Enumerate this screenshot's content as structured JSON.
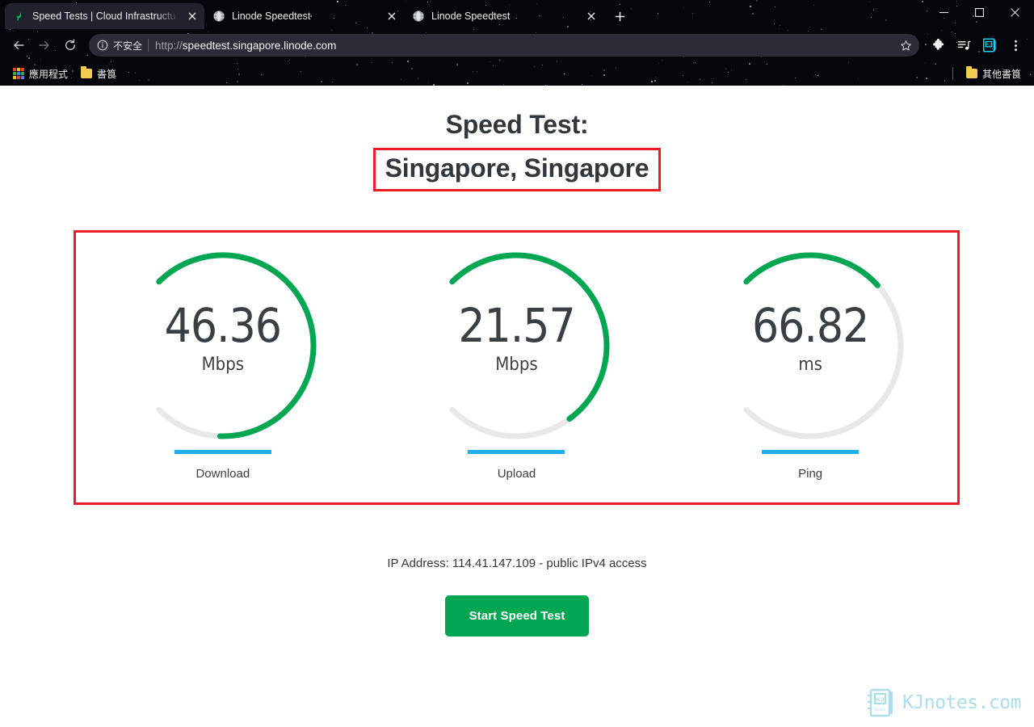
{
  "window": {
    "controls": [
      {
        "name": "minimize",
        "label": "—"
      },
      {
        "name": "maximize",
        "label": "□"
      },
      {
        "name": "close",
        "label": "✕"
      }
    ]
  },
  "tabs": [
    {
      "title": "Speed Tests | Cloud Infrastructu",
      "favicon": "linode-leaf-icon",
      "active": true
    },
    {
      "title": "Linode Speedtest",
      "favicon": "globe-icon",
      "active": false
    },
    {
      "title": "Linode Speedtest",
      "favicon": "globe-icon",
      "active": false
    }
  ],
  "newtab_label": "+",
  "toolbar": {
    "back_icon": "arrow-left-icon",
    "forward_icon": "arrow-right-icon",
    "reload_icon": "reload-icon",
    "security_icon": "info-circle-icon",
    "security_text": "不安全",
    "url_scheme": "http://",
    "url_host": "speedtest.singapore.linode.com",
    "url_full": "http://speedtest.singapore.linode.com",
    "bookmark_icon": "star-icon",
    "extensions_icon": "puzzle-icon",
    "media_icon": "media-list-icon",
    "brand_icon": "kjnotes-icon",
    "menu_icon": "more-vertical-icon"
  },
  "bookmarks": {
    "apps_label": "應用程式",
    "apps_icon": "apps-grid-icon",
    "items": [
      {
        "label": "書筤",
        "icon": "folder-icon"
      }
    ],
    "other_label": "其他書筤",
    "other_icon": "folder-icon"
  },
  "page": {
    "heading_line1": "Speed Test:",
    "heading_line2": "Singapore, Singapore",
    "ip_line": "IP Address: 114.41.147.109 - public IPv4 access",
    "cta_label": "Start Speed Test",
    "accent_green": "#00a651",
    "accent_blue": "#1cb0ee",
    "annotation_red": "#ec1c24",
    "track_gray": "#e6e8ea"
  },
  "chart_data": {
    "type": "gauge",
    "title": "Speed Test: Singapore, Singapore",
    "gauges": [
      {
        "label": "Download",
        "value": "46.36",
        "unit": "Mbps",
        "fraction": 0.84,
        "color": "#00a651",
        "track": "#e6e8ea"
      },
      {
        "label": "Upload",
        "value": "21.57",
        "unit": "Mbps",
        "fraction": 0.7,
        "color": "#00a651",
        "track": "#e6e8ea"
      },
      {
        "label": "Ping",
        "value": "66.82",
        "unit": "ms",
        "fraction": 0.345,
        "color": "#00a651",
        "track": "#e6e8ea"
      }
    ],
    "arc_sweep_degrees": 270,
    "arc_start_degrees": 135
  },
  "watermark": {
    "text": "KJnotes.com",
    "logo_icon": "kjnotes-notebook-icon",
    "color": "#a9dcec"
  }
}
